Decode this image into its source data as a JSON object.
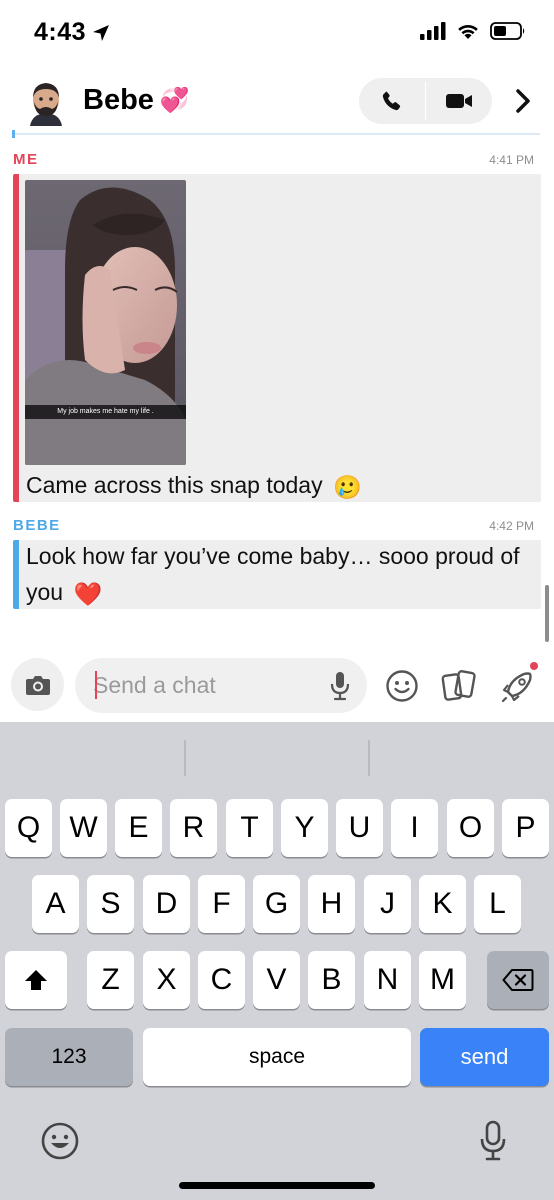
{
  "status_bar": {
    "time": "4:43"
  },
  "header": {
    "contact_name": "Bebe",
    "name_emoji": "💞"
  },
  "messages": [
    {
      "sender": "ME",
      "time": "4:41 PM",
      "snap_caption": "My job makes me hate my life .",
      "text": "Came across this snap today",
      "emoji": "🥲",
      "color": "#e34457"
    },
    {
      "sender": "BEBE",
      "time": "4:42 PM",
      "text": "Look how far you’ve come baby… sooo proud of you",
      "emoji": "❤️",
      "color": "#4fa9e7"
    }
  ],
  "input": {
    "placeholder": "Send a chat"
  },
  "keyboard": {
    "row1": [
      "Q",
      "W",
      "E",
      "R",
      "T",
      "Y",
      "U",
      "I",
      "O",
      "P"
    ],
    "row2": [
      "A",
      "S",
      "D",
      "F",
      "G",
      "H",
      "J",
      "K",
      "L"
    ],
    "row3": [
      "Z",
      "X",
      "C",
      "V",
      "B",
      "N",
      "M"
    ],
    "numbers_label": "123",
    "space_label": "space",
    "send_label": "send",
    "send_color": "#3a82f7"
  },
  "icons": {
    "location": "location-arrow-icon",
    "signal": "cellular-signal-icon",
    "wifi": "wifi-icon",
    "battery": "battery-icon",
    "phone": "phone-icon",
    "video": "video-camera-icon",
    "chevron": "chevron-right-icon",
    "camera": "camera-icon",
    "mic": "microphone-icon",
    "sticker": "smiley-icon",
    "cards": "cards-icon",
    "rocket": "rocket-icon",
    "shift": "shift-arrow-icon",
    "backspace": "backspace-icon",
    "emoji_kb": "emoji-keyboard-icon",
    "dictation": "dictation-mic-icon"
  }
}
